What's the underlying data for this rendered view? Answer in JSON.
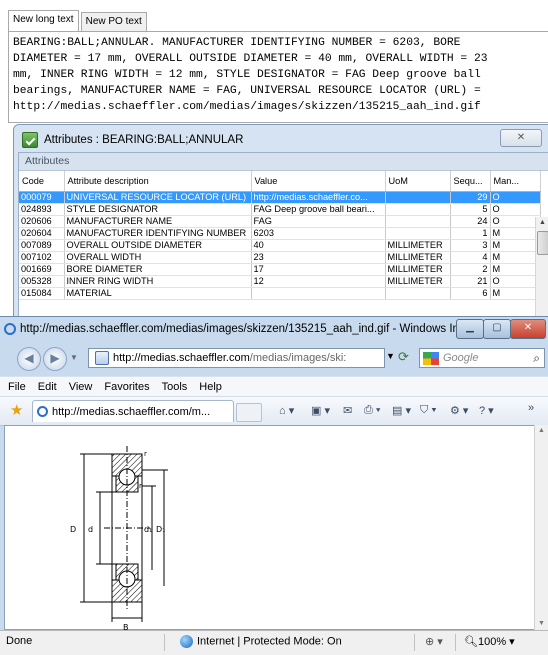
{
  "tabs": [
    "New long text",
    "New PO text"
  ],
  "long_text": [
    "BEARING:BALL;ANNULAR. MANUFACTURER IDENTIFYING NUMBER = 6203, BORE",
    "DIAMETER = 17 mm, OVERALL OUTSIDE DIAMETER = 40 mm, OVERALL WIDTH = 23",
    "mm, INNER RING WIDTH = 12 mm, STYLE DESIGNATOR = FAG Deep groove ball",
    "bearings, MANUFACTURER NAME = FAG, UNIVERSAL RESOURCE LOCATOR (URL) =",
    "http://medias.schaeffler.com/medias/images/skizzen/135215_aah_ind.gif"
  ],
  "attributes": {
    "title": "Attributes : BEARING:BALL;ANNULAR",
    "close_label": "✕",
    "section_label": "Attributes",
    "columns": [
      "Code",
      "Attribute description",
      "Value",
      "UoM",
      "Sequ...",
      "Man..."
    ],
    "rows": [
      [
        "000079",
        "UNIVERSAL RESOURCE LOCATOR (URL)",
        "http://medias.schaeffler.co...",
        "",
        "29",
        "O"
      ],
      [
        "024893",
        "STYLE DESIGNATOR",
        "FAG Deep groove ball beari...",
        "",
        "5",
        "O"
      ],
      [
        "020606",
        "MANUFACTURER NAME",
        "FAG",
        "",
        "24",
        "O"
      ],
      [
        "020604",
        "MANUFACTURER IDENTIFYING NUMBER",
        "6203",
        "",
        "1",
        "M"
      ],
      [
        "007089",
        "OVERALL OUTSIDE DIAMETER",
        "40",
        "MILLIMETER",
        "3",
        "M"
      ],
      [
        "007102",
        "OVERALL WIDTH",
        "23",
        "MILLIMETER",
        "4",
        "M"
      ],
      [
        "001669",
        "BORE DIAMETER",
        "17",
        "MILLIMETER",
        "2",
        "M"
      ],
      [
        "005328",
        "INNER RING WIDTH",
        "12",
        "MILLIMETER",
        "21",
        "O"
      ],
      [
        "015084",
        "MATERIAL",
        "",
        "",
        "6",
        "M"
      ]
    ]
  },
  "browser": {
    "window_title": "http://medias.schaeffler.com/medias/images/skizzen/135215_aah_ind.gif - Windows In...",
    "address_host": "http://medias.schaeffler.com",
    "address_path": "/medias/images/ski:",
    "search_placeholder": "Google",
    "menu": [
      "File",
      "Edit",
      "View",
      "Favorites",
      "Tools",
      "Help"
    ],
    "tab_title": "http://medias.schaeffler.com/m...",
    "status_done": "Done",
    "status_zone": "Internet | Protected Mode: On",
    "zoom": "100%"
  },
  "drawing_labels": {
    "r_top": "r",
    "r_inner": "r",
    "D": "D",
    "d": "d",
    "d1": "d₁",
    "D1": "D₁",
    "B": "B"
  },
  "colors": {
    "selection": "#3399ff",
    "dialog_frame": "#d5e3f2",
    "ie_frame": "#c8daee",
    "close_red": "#c8412d"
  }
}
